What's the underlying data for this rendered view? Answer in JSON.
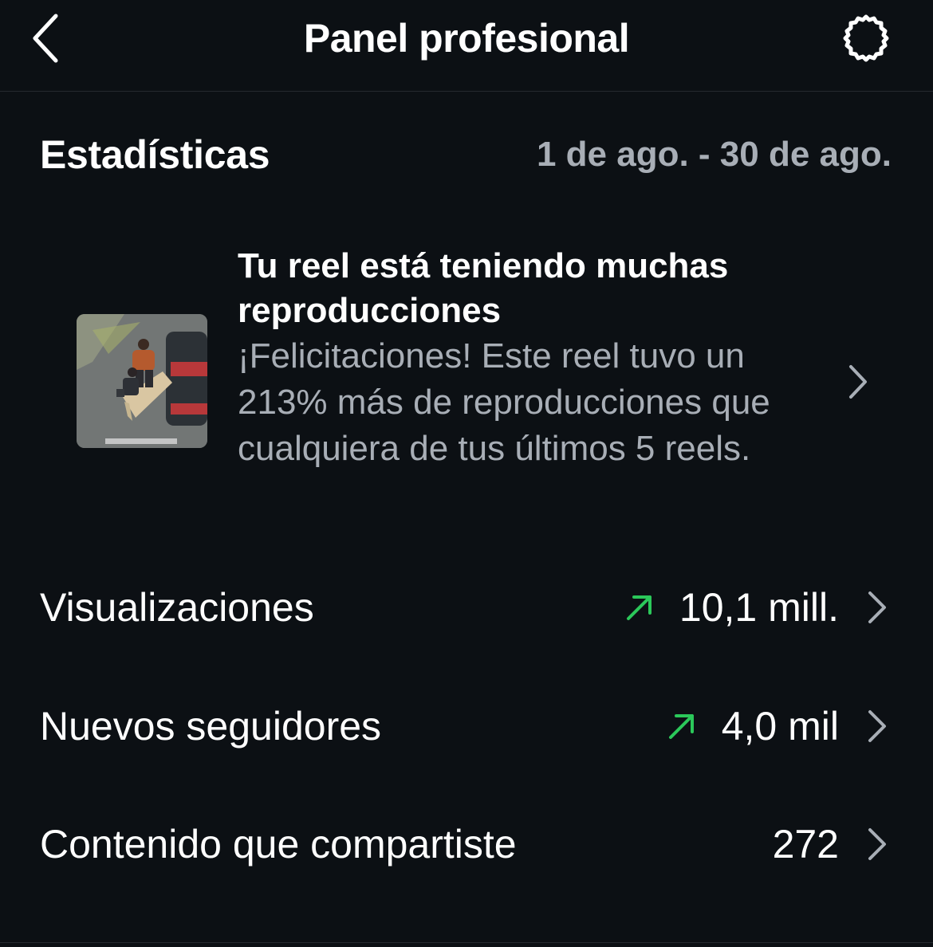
{
  "header": {
    "title": "Panel profesional",
    "back_icon": "chevron-left-icon",
    "settings_icon": "gear-icon"
  },
  "stats": {
    "title": "Estadísticas",
    "date_range": "1 de ago. - 30 de ago."
  },
  "insight": {
    "title": "Tu reel está teniendo muchas reproducciones",
    "body": "¡Felicitaciones! Este reel tuvo un 213% más de reproducciones que cualquiera de tus últimos 5 reels."
  },
  "metrics": [
    {
      "label": "Visualizaciones",
      "value": "10,1 mill.",
      "trend": "up"
    },
    {
      "label": "Nuevos seguidores",
      "value": "4,0 mil",
      "trend": "up"
    },
    {
      "label": "Contenido que compartiste",
      "value": "272",
      "trend": "none"
    }
  ],
  "colors": {
    "background": "#0c1014",
    "text_primary": "#ffffff",
    "text_secondary": "#a8aeb6",
    "trend_up": "#2bc85a",
    "divider": "#262a2f"
  }
}
